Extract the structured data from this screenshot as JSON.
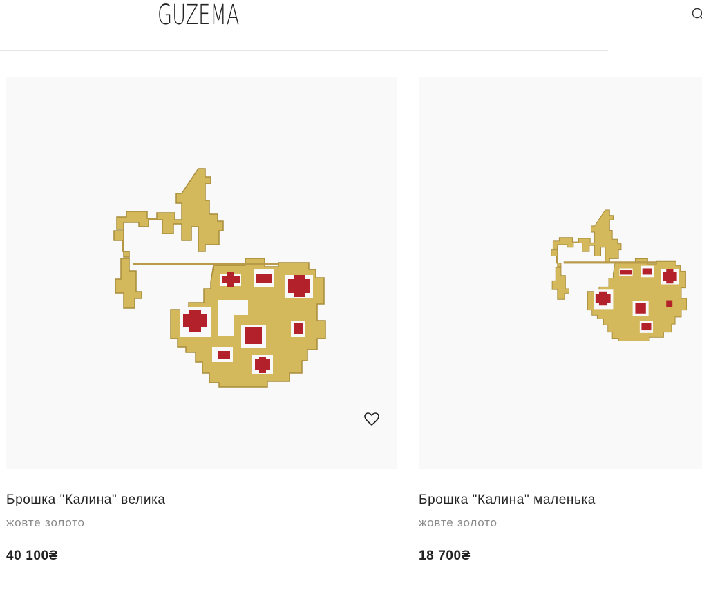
{
  "header": {
    "logo": "GUZEMA",
    "search_icon": "search-icon"
  },
  "products": [
    {
      "title": "Брошка \"Калина\" велика",
      "material": "жовте золото",
      "price": "40 100₴",
      "image": "brooch-large",
      "wishlist_icon": "heart-icon"
    },
    {
      "title": "Брошка \"Калина\" маленька",
      "material": "жовте золото",
      "price": "18 700₴",
      "image": "brooch-small"
    }
  ],
  "colors": {
    "gold": "#d4b85c",
    "red": "#b3212a",
    "image_bg": "#f9f9f9",
    "muted_text": "#8a8a8a"
  }
}
